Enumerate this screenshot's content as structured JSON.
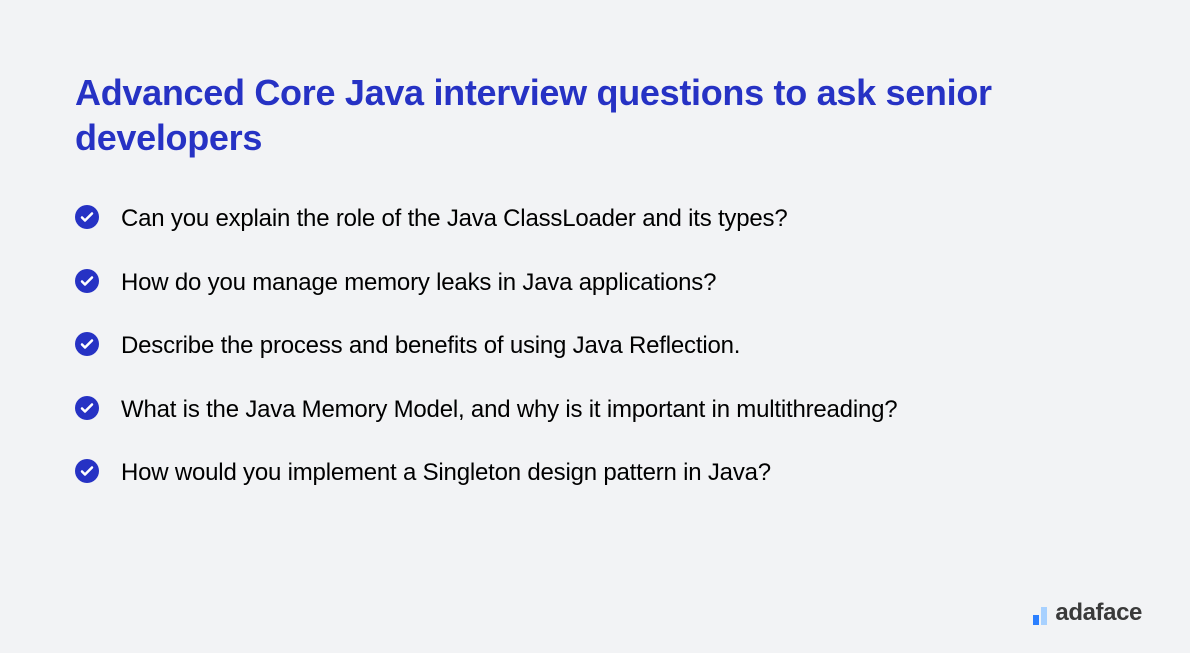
{
  "title": "Advanced Core Java interview questions to ask senior developers",
  "questions": [
    "Can you explain the role of the Java ClassLoader and its types?",
    "How do you manage memory leaks in Java applications?",
    "Describe the process and benefits of using Java Reflection.",
    "What is the Java Memory Model, and why is it important in multithreading?",
    "How would you implement a Singleton design pattern in Java?"
  ],
  "logo": {
    "text": "adaface"
  },
  "colors": {
    "accent": "#2632c4",
    "background": "#f2f3f5",
    "text": "#000000",
    "logoBlue": "#2b7fff",
    "logoLightBlue": "#a8d1ff"
  }
}
